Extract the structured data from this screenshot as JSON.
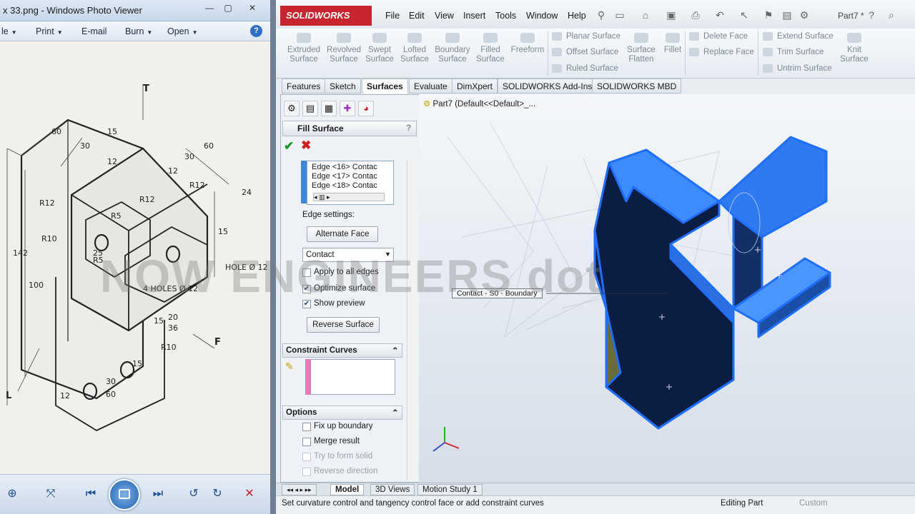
{
  "photo_viewer": {
    "title": "x 33.png - Windows Photo Viewer",
    "menu": [
      "le",
      "Print",
      "E-mail",
      "Burn",
      "Open"
    ],
    "help": "?",
    "drawing": {
      "dims": [
        "60",
        "15",
        "12",
        "30",
        "12",
        "60",
        "30",
        "R12",
        "R12",
        "R5",
        "R12",
        "R10",
        "24",
        "R5",
        "15",
        "142",
        "100",
        "25",
        "4 HOLES Ø 12",
        "HOLE Ø 12",
        "20",
        "36",
        "15",
        "R10",
        "30",
        "12",
        "60",
        "15"
      ],
      "arrows": [
        "T",
        "F",
        "L"
      ]
    }
  },
  "solidworks": {
    "logo": "SOLIDWORKS",
    "menu": [
      "File",
      "Edit",
      "View",
      "Insert",
      "Tools",
      "Window",
      "Help"
    ],
    "part_name": "Part7 *",
    "commands_big": [
      {
        "label": "Extruded Surface"
      },
      {
        "label": "Revolved Surface"
      },
      {
        "label": "Swept Surface"
      },
      {
        "label": "Lofted Surface"
      },
      {
        "label": "Boundary Surface"
      },
      {
        "label": "Filled Surface"
      },
      {
        "label": "Freeform"
      }
    ],
    "commands_col1": [
      "Planar Surface",
      "Offset Surface",
      "Ruled Surface"
    ],
    "commands_mid": [
      {
        "label": "Surface Flatten"
      },
      {
        "label": "Fillet"
      }
    ],
    "commands_col2": [
      "Delete Face",
      "Replace Face"
    ],
    "commands_col3": [
      "Extend Surface",
      "Trim Surface",
      "Untrim Surface"
    ],
    "knit": "Knit Surface",
    "tabs": [
      "Features",
      "Sketch",
      "Surfaces",
      "Evaluate",
      "DimXpert",
      "SOLIDWORKS Add-Ins",
      "SOLIDWORKS MBD"
    ],
    "active_tab": "Surfaces",
    "feature_manager": {
      "title": "Fill Surface",
      "help": "?",
      "edges": [
        "Edge <16> Contac",
        "Edge <17> Contac",
        "Edge <18> Contac"
      ],
      "edge_settings_label": "Edge settings:",
      "alternate_face": "Alternate Face",
      "contact_value": "Contact",
      "checkboxes": [
        {
          "label": "Apply to all edges",
          "checked": false
        },
        {
          "label": "Optimize surface",
          "checked": true
        },
        {
          "label": "Show preview",
          "checked": true
        }
      ],
      "reverse_surface": "Reverse Surface",
      "constraint_curves": "Constraint Curves",
      "options": "Options",
      "options_list": [
        {
          "label": "Fix up boundary",
          "enabled": true
        },
        {
          "label": "Merge result",
          "enabled": true
        },
        {
          "label": "Try to form solid",
          "enabled": false
        },
        {
          "label": "Reverse direction",
          "enabled": false
        }
      ]
    },
    "tree_label": "Part7  (Default<<Default>_...",
    "callout": "Contact - S0 - Boundary",
    "bottom_tabs": [
      "Model",
      "3D Views",
      "Motion Study 1"
    ],
    "status_text": "Set curvature control and tangency control face or add constraint curves",
    "status_mode": "Editing Part",
    "status_units": "Custom"
  },
  "watermark": "NOW ENGINEERS dot"
}
